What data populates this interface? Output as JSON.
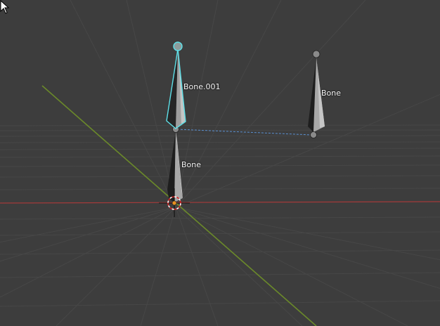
{
  "viewport": {
    "background_color": "#3d3d3d",
    "grid_color": "#4a4a4a",
    "x_axis_color": "#a33a3a",
    "y_axis_color": "#6b8a2a"
  },
  "bones": {
    "selected": {
      "label": "Bone.001",
      "outline_color": "#5ee0e8",
      "state": "selected"
    },
    "parent": {
      "label": "Bone",
      "state": "unselected"
    },
    "other": {
      "label": "Bone",
      "state": "unselected"
    }
  },
  "relationship_line_color": "#5a8fd0",
  "icons": {
    "origin": "3d-cursor-icon",
    "pointer": "mouse-pointer-icon"
  }
}
